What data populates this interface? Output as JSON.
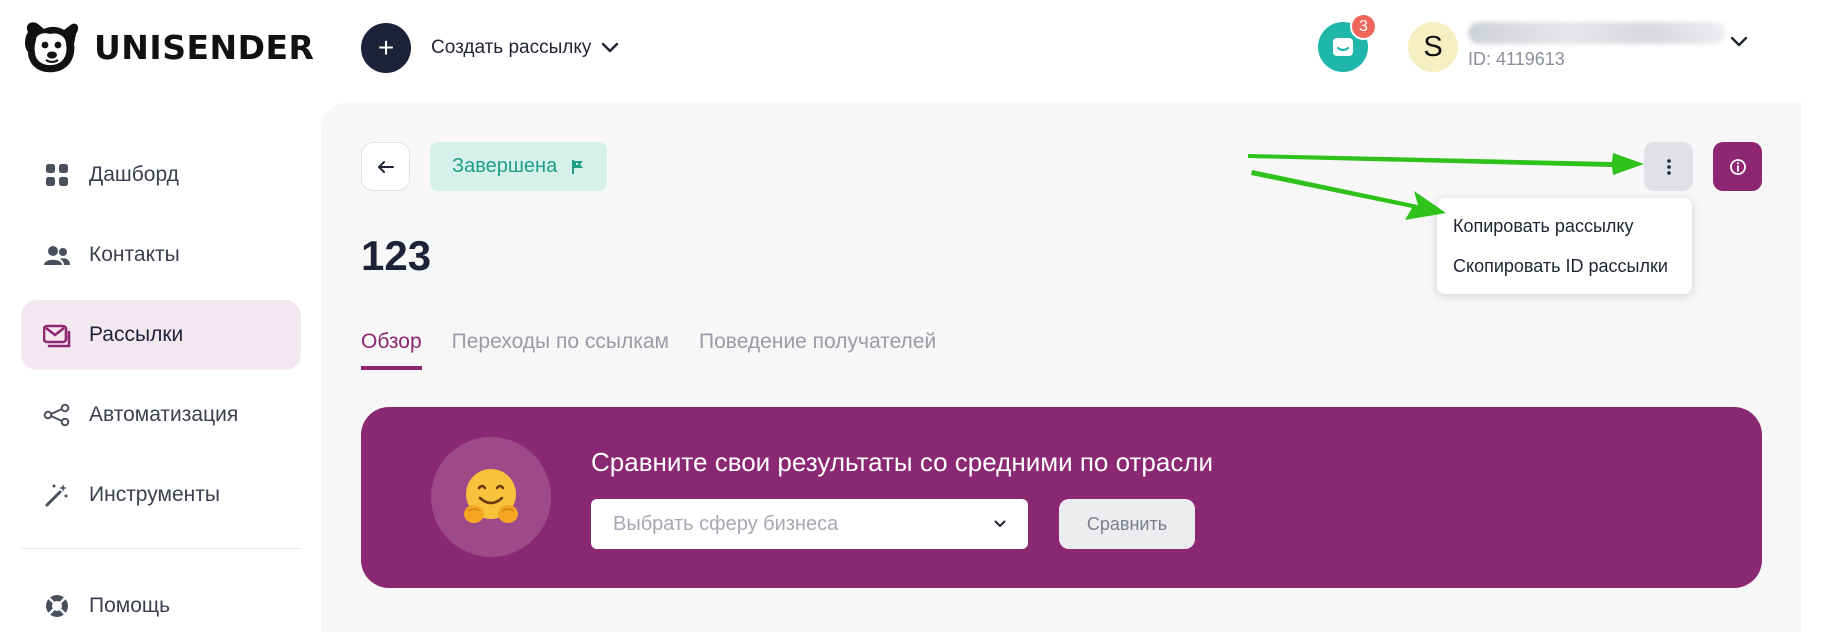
{
  "brand": {
    "name": "UNISENDER"
  },
  "header": {
    "create_label": "Создать рассылку",
    "inbox_badge": "3",
    "avatar_letter": "S",
    "account_id": "ID: 4119613"
  },
  "sidebar": {
    "items": [
      {
        "label": "Дашборд",
        "icon": "dashboard-icon"
      },
      {
        "label": "Контакты",
        "icon": "contacts-icon"
      },
      {
        "label": "Рассылки",
        "icon": "mail-icon",
        "active": true
      },
      {
        "label": "Автоматизация",
        "icon": "automation-icon"
      },
      {
        "label": "Инструменты",
        "icon": "tools-icon"
      }
    ],
    "help": {
      "label": "Помощь",
      "icon": "help-icon"
    }
  },
  "campaign": {
    "status": "Завершена",
    "title": "123"
  },
  "tabs": [
    {
      "label": "Обзор",
      "active": true
    },
    {
      "label": "Переходы по ссылкам"
    },
    {
      "label": "Поведение получателей"
    }
  ],
  "more_menu": {
    "items": [
      {
        "label": "Копировать рассылку"
      },
      {
        "label": "Скопировать ID рассылки"
      }
    ]
  },
  "banner": {
    "title": "Сравните свои результаты со средними по отрасли",
    "select_placeholder": "Выбрать сферу бизнеса",
    "compare_label": "Сравнить"
  },
  "colors": {
    "accent": "#8e2772",
    "banner": "#8b2873",
    "status_bg": "#d5f1ea",
    "status_text": "#1f9f88",
    "inbox": "#1fb7a9",
    "badge": "#f0665b",
    "annotation_arrow": "#2ec21a"
  }
}
